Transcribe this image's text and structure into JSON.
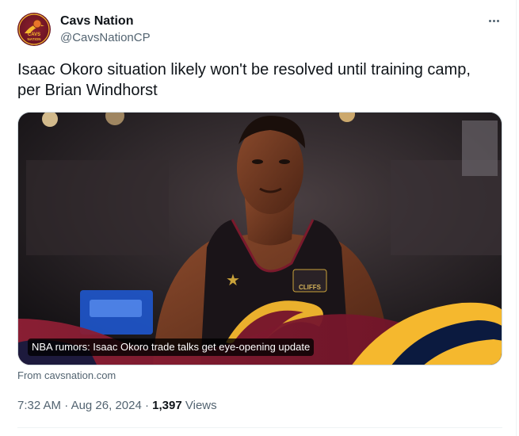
{
  "author": {
    "name": "Cavs Nation",
    "handle": "@CavsNationCP",
    "avatar_icon": "cavs-nation-logo",
    "avatar_text": "CAVS NATION"
  },
  "tweet": {
    "text": "Isaac Okoro situation likely won't be resolved until training camp, per Brian Windhorst"
  },
  "card": {
    "caption": "NBA rumors: Isaac Okoro trade talks get eye-opening update",
    "source": "From cavsnation.com",
    "jersey_sponsor": "CLIFFS"
  },
  "meta": {
    "time": "7:32 AM",
    "separator": "·",
    "date": "Aug 26, 2024",
    "views_count": "1,397",
    "views_label": "Views"
  },
  "colors": {
    "text_primary": "#0f1419",
    "text_secondary": "#536471",
    "wine": "#6f1524",
    "gold": "#f5b82e",
    "navy": "#0b1a3f"
  }
}
